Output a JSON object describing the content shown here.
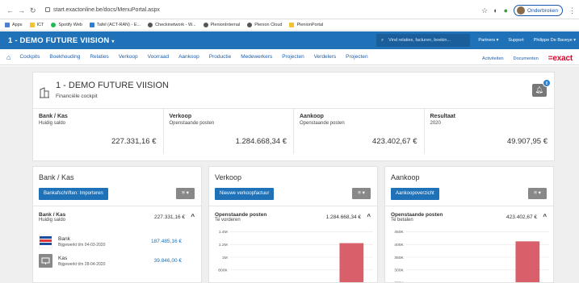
{
  "browser": {
    "url": "start.exactonline.be/docs/MenuPortal.aspx",
    "profile_label": "Onderbroken",
    "bookmarks": [
      "Apps",
      "ICT",
      "Spotify Web",
      "Tafel (ACT-RAN) - E...",
      "Checkinetwork - W...",
      "PlenionInternal",
      "Plenion Cloud",
      "PlenionPortal"
    ]
  },
  "app": {
    "company_title": "1 - DEMO FUTURE VIISION",
    "search_placeholder": "Vind relaties, facturen, boekin...",
    "header_links": [
      "Partners",
      "Support",
      "Philippe De Baveye"
    ]
  },
  "menu": {
    "items": [
      "Cockpits",
      "Boekhouding",
      "Relaties",
      "Verkoop",
      "Voorraad",
      "Aankoop",
      "Productie",
      "Medewerkers",
      "Projecten",
      "Verdelers",
      "Projecten"
    ],
    "right_items": [
      "Activiteiten",
      "Documenten"
    ],
    "logo": "=exact"
  },
  "cockpit": {
    "title": "1 - DEMO FUTURE VIISION",
    "subtitle": "Financiële cockpit",
    "notification_count": "8",
    "kpis": [
      {
        "title": "Bank / Kas",
        "sub": "Huidig saldo",
        "value": "227.331,16 €"
      },
      {
        "title": "Verkoop",
        "sub": "Openstaande posten",
        "value": "1.284.668,34 €"
      },
      {
        "title": "Aankoop",
        "sub": "Openstaande posten",
        "value": "423.402,67 €"
      },
      {
        "title": "Resultaat",
        "sub": "2020",
        "value": "49.907,95 €"
      }
    ]
  },
  "panels": {
    "bank": {
      "title": "Bank / Kas",
      "button": "Bankafschriften: Importeren",
      "menu": "≡ ▾",
      "section_title": "Bank / Kas",
      "section_sub": "Huidig saldo",
      "section_value": "227.331,16 €",
      "accounts": [
        {
          "name": "Bank",
          "sub": "Bijgewerkt t/m 04-03-2020",
          "value": "187.485,16 €"
        },
        {
          "name": "Kas",
          "sub": "Bijgewerkt t/m 28-04-2020",
          "value": "39.846,00 €"
        }
      ]
    },
    "verkoop": {
      "title": "Verkoop",
      "button": "Nieuwe verkoopfactuur",
      "menu": "≡ ▾",
      "section_title": "Openstaande posten",
      "section_sub": "Te vorderen",
      "section_value": "1.284.668,34 €"
    },
    "aankoop": {
      "title": "Aankoop",
      "button": "Aankoopoverzicht",
      "menu": "≡ ▾",
      "section_title": "Openstaande posten",
      "section_sub": "Te betalen",
      "section_value": "423.402,67 €"
    }
  },
  "chart_data": [
    {
      "type": "bar",
      "ytick_labels": [
        "1.4M",
        "1.2M",
        "1M",
        "800K"
      ],
      "ytick_values": [
        1400000,
        1200000,
        1000000,
        800000
      ],
      "values": [
        1220000
      ],
      "ylim": [
        800000,
        1400000
      ],
      "bar_color": "#d9606a"
    },
    {
      "type": "bar",
      "ytick_labels": [
        "450K",
        "400K",
        "350K",
        "300K",
        "250K"
      ],
      "ytick_values": [
        450000,
        400000,
        350000,
        300000,
        250000
      ],
      "values": [
        412000
      ],
      "ylim": [
        250000,
        450000
      ],
      "bar_color": "#d9606a"
    }
  ]
}
